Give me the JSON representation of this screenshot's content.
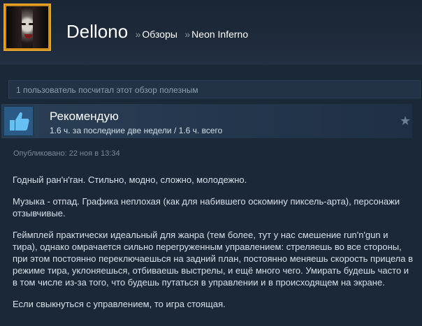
{
  "header": {
    "user_name": "Dellono",
    "separator": "»",
    "section": "Обзоры",
    "game": "Neon Inferno"
  },
  "helpful_text": "1 пользователь посчитал этот обзор полезным",
  "recommendation": {
    "title": "Рекомендую",
    "hours": "1.6 ч. за последние две недели / 1.6 ч. всего"
  },
  "posted": "Опубликовано: 22 ноя в 13:34",
  "review": {
    "paragraphs": [
      "Годный ран'н'ган. Стильно, модно, сложно, молодежно.",
      "Музыка - отпад. Графика неплохая (как для набившего оскомину пиксель-арта), персонажи отзывчивые.",
      "Геймплей практически идеальный для жанра (тем более, тут у нас смешение run'n'gun и тира), однако омрачается сильно перегруженным управлением: стреляешь во все стороны, при этом постоянно переключаешься на задний план, постоянно меняешь скорость прицела в режиме тира, уклоняешься, отбиваешь выстрелы, и ещё много чего. Умирать будешь часто и в том числе из-за того, что будешь путаться в управлении и в происходящем на экране.",
      "Если свыкнуться с управлением, то игра стоящая."
    ]
  },
  "colors": {
    "background": "#1b2838",
    "accent_blue": "#66c0f4",
    "avatar_border": "#e7a52b"
  },
  "icons": {
    "recommend": "thumbs-up-icon",
    "favorite": "star-icon"
  }
}
